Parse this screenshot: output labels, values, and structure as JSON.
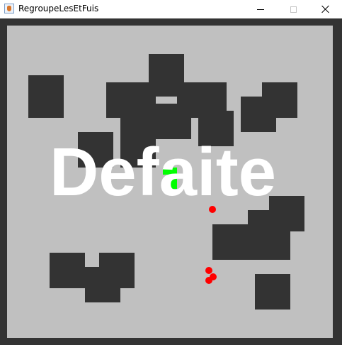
{
  "window": {
    "title": "RegroupeLesEtFuis",
    "icon": "java-cup-icon",
    "controls": [
      "minimize-icon",
      "maximize-icon",
      "close-icon"
    ]
  },
  "game": {
    "message": "Defaite",
    "colors": {
      "border": "#333333",
      "floor": "#c0c0c0",
      "wall": "#333333",
      "enemy": "#ff0000",
      "player": "#00ff00",
      "message": "#ffffff"
    },
    "enemy_count": 4,
    "player_count": 1
  }
}
